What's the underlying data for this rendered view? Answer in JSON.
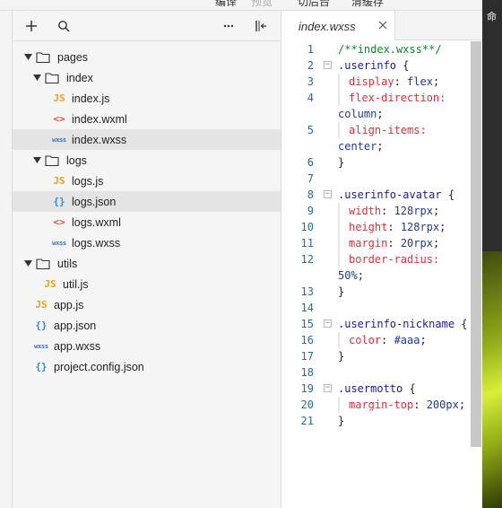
{
  "topbar": {
    "items": [
      "编译",
      "预览",
      "切后台",
      "清缓存"
    ]
  },
  "right_strip": {
    "text": "命"
  },
  "explorer": {
    "toolbar": {
      "add_icon": "plus-icon",
      "search_icon": "search-icon",
      "more_icon": "more-icon",
      "collapse_icon": "collapse-panel-icon"
    },
    "tree": {
      "pages": "pages",
      "index": "index",
      "index_js": "index.js",
      "index_wxml": "index.wxml",
      "index_wxss": "index.wxss",
      "logs": "logs",
      "logs_js": "logs.js",
      "logs_json": "logs.json",
      "logs_wxml": "logs.wxml",
      "logs_wxss": "logs.wxss",
      "utils": "utils",
      "util_js": "util.js",
      "app_js": "app.js",
      "app_json": "app.json",
      "app_wxss": "app.wxss",
      "project_config": "project.config.json"
    },
    "badges": {
      "js": "JS",
      "wxml": "<>",
      "json": "{}",
      "wxss": "wxss"
    }
  },
  "editor": {
    "tab_label": "index.wxss",
    "tab_close_icon": "close-icon",
    "lines": [
      {
        "n": "1",
        "comment": "/**index.wxss**/"
      },
      {
        "n": "2",
        "selector": ".userinfo",
        "brace": " {"
      },
      {
        "n": "3",
        "prop": "display",
        "value": "flex"
      },
      {
        "n": "4",
        "prop": "flex-direction",
        "value": ""
      },
      {
        "wrap_value": "column"
      },
      {
        "n": "5",
        "prop": "align-items",
        "value": ""
      },
      {
        "wrap_value": "center"
      },
      {
        "n": "6",
        "close": "}"
      },
      {
        "n": "7"
      },
      {
        "n": "8",
        "selector": ".userinfo-avatar",
        "brace": " {"
      },
      {
        "n": "9",
        "prop": "width",
        "value": "128rpx"
      },
      {
        "n": "10",
        "prop": "height",
        "value": "128rpx"
      },
      {
        "n": "11",
        "prop": "margin",
        "value": "20rpx"
      },
      {
        "n": "12",
        "prop": "border-radius",
        "value": ""
      },
      {
        "wrap_value": "50%"
      },
      {
        "n": "13",
        "close": "}"
      },
      {
        "n": "14"
      },
      {
        "n": "15",
        "selector": ".userinfo-nickname",
        "brace": " {"
      },
      {
        "n": "16",
        "prop": "color",
        "value": "#aaa"
      },
      {
        "n": "17",
        "close": "}"
      },
      {
        "n": "18"
      },
      {
        "n": "19",
        "selector": ".usermotto",
        "brace": " {"
      },
      {
        "n": "20",
        "prop": "margin-top",
        "value": "200px"
      },
      {
        "n": "21",
        "close": "}"
      }
    ]
  },
  "colors": {
    "line_number": "#2b6b9d",
    "comment": "#0b8a2b",
    "selector": "#1a1aa6",
    "property": "#e0303d",
    "value": "#1f3a93",
    "js_badge": "#e6a41a",
    "wxml_badge": "#e8533a",
    "json_badge": "#2f8fd8",
    "wxss_badge": "#2f72c9"
  }
}
